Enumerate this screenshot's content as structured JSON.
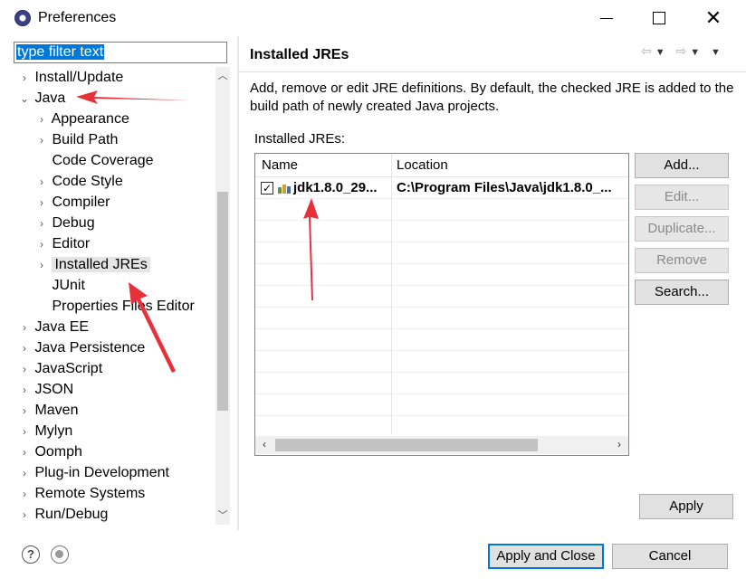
{
  "window": {
    "title": "Preferences"
  },
  "filter": {
    "placeholder": "type filter text"
  },
  "tree": [
    {
      "label": "Install/Update",
      "expander": "›",
      "indent": 0
    },
    {
      "label": "Java",
      "expander": "⌄",
      "indent": 0
    },
    {
      "label": "Appearance",
      "expander": "›",
      "indent": 1
    },
    {
      "label": "Build Path",
      "expander": "›",
      "indent": 1
    },
    {
      "label": "Code Coverage",
      "expander": "",
      "indent": 1
    },
    {
      "label": "Code Style",
      "expander": "›",
      "indent": 1
    },
    {
      "label": "Compiler",
      "expander": "›",
      "indent": 1
    },
    {
      "label": "Debug",
      "expander": "›",
      "indent": 1
    },
    {
      "label": "Editor",
      "expander": "›",
      "indent": 1
    },
    {
      "label": "Installed JREs",
      "expander": "›",
      "indent": 1,
      "selected": true
    },
    {
      "label": "JUnit",
      "expander": "",
      "indent": 1
    },
    {
      "label": "Properties Files Editor",
      "expander": "",
      "indent": 1
    },
    {
      "label": "Java EE",
      "expander": "›",
      "indent": 0
    },
    {
      "label": "Java Persistence",
      "expander": "›",
      "indent": 0
    },
    {
      "label": "JavaScript",
      "expander": "›",
      "indent": 0
    },
    {
      "label": "JSON",
      "expander": "›",
      "indent": 0
    },
    {
      "label": "Maven",
      "expander": "›",
      "indent": 0
    },
    {
      "label": "Mylyn",
      "expander": "›",
      "indent": 0
    },
    {
      "label": "Oomph",
      "expander": "›",
      "indent": 0
    },
    {
      "label": "Plug-in Development",
      "expander": "›",
      "indent": 0
    },
    {
      "label": "Remote Systems",
      "expander": "›",
      "indent": 0
    },
    {
      "label": "Run/Debug",
      "expander": "›",
      "indent": 0
    }
  ],
  "page": {
    "title": "Installed JREs",
    "description": "Add, remove or edit JRE definitions. By default, the checked JRE is added to the build path of newly created Java projects.",
    "list_label": "Installed JREs:"
  },
  "table": {
    "columns": [
      "Name",
      "Location"
    ],
    "rows": [
      {
        "checked": true,
        "name": "jdk1.8.0_29...",
        "location": "C:\\Program Files\\Java\\jdk1.8.0_..."
      }
    ]
  },
  "buttons": {
    "add": "Add...",
    "edit": "Edit...",
    "duplicate": "Duplicate...",
    "remove": "Remove",
    "search": "Search...",
    "apply": "Apply",
    "apply_close": "Apply and Close",
    "cancel": "Cancel"
  },
  "icons": {
    "help": "?",
    "check": "✓"
  },
  "colors": {
    "accent": "#0078d7",
    "annotation": "#e8303a"
  }
}
